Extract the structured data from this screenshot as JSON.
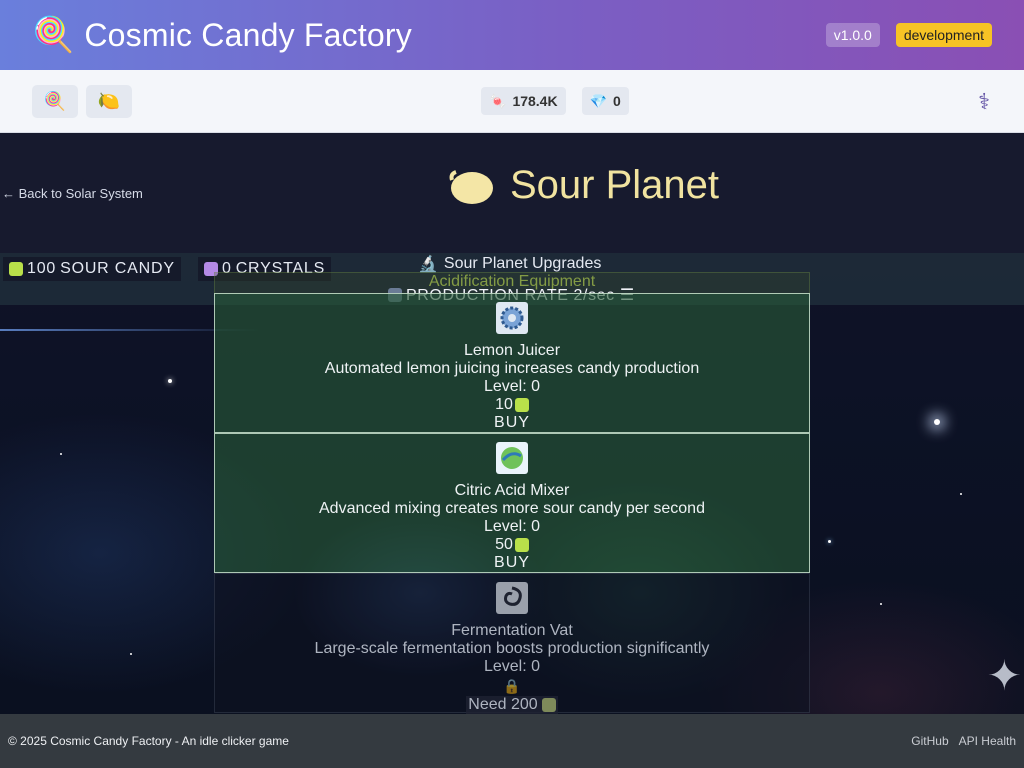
{
  "header": {
    "logo_icon": "lollipop-icon",
    "title": "Cosmic Candy Factory",
    "version": "v1.0.0",
    "environment": "development"
  },
  "toolbar": {
    "buttons": [
      {
        "icon": "lollipop-icon",
        "glyph": "🍭"
      },
      {
        "icon": "lemon-icon",
        "glyph": "🍋"
      }
    ],
    "currencies": [
      {
        "icon": "candy-icon",
        "glyph": "🍬",
        "value": "178.4K"
      },
      {
        "icon": "gem-icon",
        "glyph": "💎",
        "value": "0"
      }
    ],
    "admin_icon": "caduceus-icon"
  },
  "planet": {
    "back_label": "← Back to Solar System",
    "title": "Sour Planet",
    "stats": [
      {
        "amount": "100",
        "label": "SOUR CANDY",
        "color": "#b9e04a"
      },
      {
        "amount": "0",
        "label": "CRYSTALS",
        "color": "#b48ae6"
      }
    ],
    "upgrades_heading": "Sour Planet Upgrades",
    "section_title": "Acidification Equipment",
    "production_rate": "PRODUCTION RATE 2/sec ☰",
    "upgrades": [
      {
        "name": "Lemon Juicer",
        "description": "Automated lemon juicing increases candy production",
        "level": "Level: 0",
        "cost": "10",
        "action": "BUY",
        "state": "available",
        "icon": "gear-icon"
      },
      {
        "name": "Citric Acid Mixer",
        "description": "Advanced mixing creates more sour candy per second",
        "level": "Level: 0",
        "cost": "50",
        "action": "BUY",
        "state": "available",
        "icon": "mixer-orb-icon"
      },
      {
        "name": "Fermentation Vat",
        "description": "Large-scale fermentation boosts production significantly",
        "level": "Level: 0",
        "cost": "Need 200",
        "action": "",
        "state": "locked",
        "icon": "swirl-icon"
      }
    ]
  },
  "footer": {
    "copyright": "© 2025 Cosmic Candy Factory - An idle clicker game",
    "links": [
      "GitHub",
      "API Health"
    ]
  }
}
